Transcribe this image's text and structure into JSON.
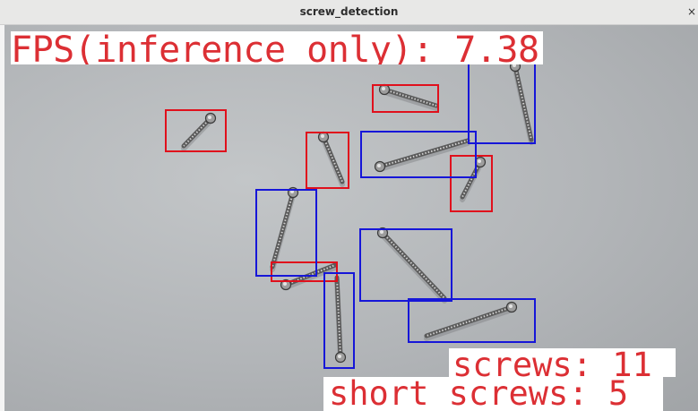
{
  "window": {
    "title": "screw_detection",
    "close_glyph": "×"
  },
  "overlay": {
    "fps_text": "FPS(inference only): 7.38",
    "screws_text": "screws: 11",
    "short_screws_text": "short screws: 5"
  },
  "detections": {
    "total": 11,
    "short": 5,
    "long": 6
  },
  "colors": {
    "short_box": "#e0101c",
    "long_box": "#1616d8",
    "overlay_text": "#dc2f34",
    "overlay_bg": "#ffffff"
  }
}
